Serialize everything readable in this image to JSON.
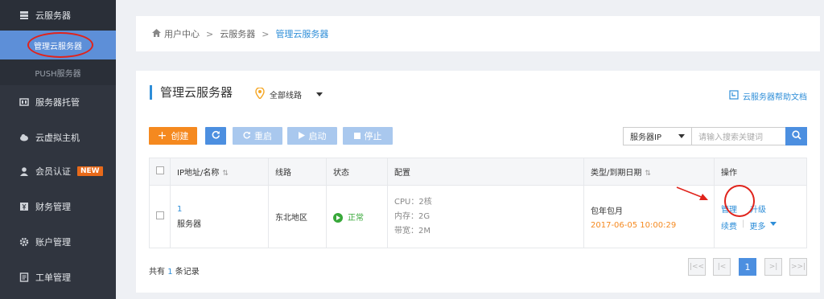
{
  "sidebar": {
    "top_item": "云服务器",
    "sub_active": "管理云服务器",
    "sub_item": "PUSH服务器",
    "items": [
      {
        "label": "服务器托管",
        "icon": "server-hosting-icon"
      },
      {
        "label": "云虚拟主机",
        "icon": "cloud-host-icon"
      },
      {
        "label": "会员认证",
        "icon": "user-icon",
        "badge": "NEW"
      },
      {
        "label": "财务管理",
        "icon": "yen-icon"
      },
      {
        "label": "账户管理",
        "icon": "gear-icon"
      },
      {
        "label": "工单管理",
        "icon": "list-icon"
      }
    ]
  },
  "breadcrumb": {
    "home": "用户中心",
    "sep1": ">",
    "level2": "云服务器",
    "sep2": ">",
    "current": "管理云服务器"
  },
  "page": {
    "title": "管理云服务器",
    "line_select": "全部线路",
    "help_link": "云服务器帮助文档"
  },
  "toolbar": {
    "create": "创建",
    "restart": "重启",
    "start": "启动",
    "stop": "停止",
    "search_type": "服务器IP",
    "search_placeholder": "请输入搜索关键词"
  },
  "table": {
    "headers": [
      "IP地址/名称",
      "线路",
      "状态",
      "配置",
      "类型/到期日期",
      "操作"
    ],
    "rows": [
      {
        "ip": "1",
        "name": "服务器",
        "line": "东北地区",
        "status": "正常",
        "cpu": "CPU：2核",
        "mem": "内存：2G",
        "bandwidth": "带宽：2M",
        "type": "包年包月",
        "expire": "2017-06-05 10:00:29",
        "actions": {
          "manage": "管理",
          "upgrade": "升级",
          "renew": "续费",
          "sep": "|",
          "more": "更多"
        }
      }
    ]
  },
  "footer": {
    "total_prefix": "共有",
    "total_count": "1",
    "total_suffix": "条记录",
    "current_page": "1"
  },
  "colors": {
    "sidebar_bg": "#30353f",
    "accent": "#2e8ed8",
    "create_button": "#f5891f",
    "active_sub": "#5d8fd8",
    "status_ok": "#38a83a",
    "annotation": "#e0231b"
  }
}
